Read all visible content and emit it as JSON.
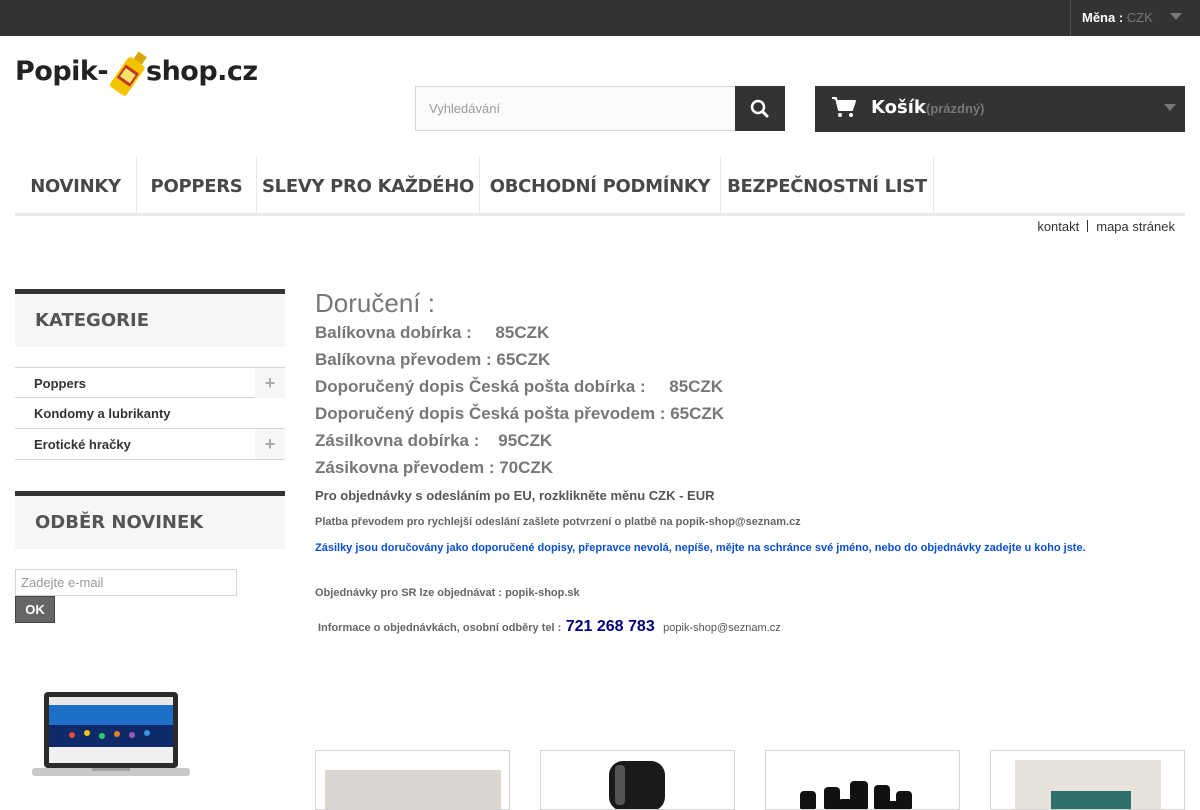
{
  "topbar": {
    "currency_label": "Měna :",
    "currency_value": "CZK"
  },
  "header": {
    "logo_left": "Popik-",
    "logo_right": "shop.cz",
    "search_placeholder": "Vyhledávání",
    "cart_title": "Košík",
    "cart_status": "(prázdný)"
  },
  "menu": [
    "NOVINKY",
    "POPPERS",
    "SLEVY PRO KAŽDÉHO",
    "OBCHODNÍ PODMÍNKY",
    "BEZPEČNOSTNÍ LIST"
  ],
  "toplinks": {
    "contact": "kontakt",
    "sitemap": "mapa stránek"
  },
  "sidebar": {
    "categories_title": "KATEGORIE",
    "categories": [
      {
        "label": "Poppers",
        "expandable": true
      },
      {
        "label": "Kondomy a lubrikanty",
        "expandable": false
      },
      {
        "label": "Erotické hračky",
        "expandable": true
      }
    ],
    "newsletter_title": "ODBĚR NOVINEK",
    "newsletter_placeholder": "Zadejte e-mail",
    "newsletter_button": "OK"
  },
  "content": {
    "heading": "Doručení :",
    "shipping": [
      "Balíkovna dobírka :     85CZK",
      "Balíkovna převodem : 65CZK",
      "Doporučený dopis Česká pošta dobírka :     85CZK",
      "Doporučený dopis Česká pošta převodem : 65CZK",
      "Zásilkovna dobírka :    95CZK",
      "Zásikovna převodem : 70CZK"
    ],
    "eu_note": "Pro objednávky s odesláním po EU, rozklikněte měnu CZK - EUR",
    "transfer_note": "Platba převodem pro rychlejší odeslání zašlete potvrzení o platbě na popik-shop@seznam.cz",
    "delivery_note": "Zásilky jsou doručovány jako doporučené dopisy, přepravce nevolá, nepíše, mějte na schránce své jméno, nebo do objednávky zadejte u koho jste.",
    "sk_note": "Objednávky pro SR lze objednávat : popik-shop.sk",
    "info_label": "Informace o objednávkách, osobní odběry tel :",
    "phone": "721 268 783",
    "email": "popik-shop@seznam.cz"
  },
  "colors": {
    "dark": "#333333",
    "blue_note": "#0a4fd0",
    "phone": "#00007a"
  }
}
